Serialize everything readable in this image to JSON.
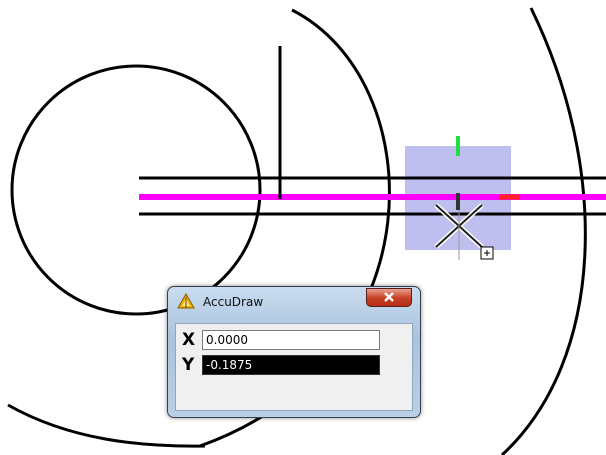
{
  "dialog": {
    "title": "AccuDraw",
    "close_icon": "close-x-icon",
    "app_icon": "accudraw-icon"
  },
  "fields": {
    "x": {
      "label": "X",
      "value": "0.0000"
    },
    "y": {
      "label": "Y",
      "value": "-0.1875"
    }
  },
  "colors": {
    "magenta": "#ff00ff",
    "compass": "#b8b8ee",
    "x_axis_marker": "#ff2020",
    "y_axis_marker": "#22dd44"
  }
}
